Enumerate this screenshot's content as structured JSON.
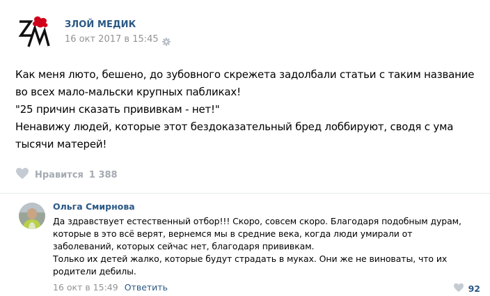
{
  "post": {
    "author": "ЗЛОЙ МЕДИК",
    "date": "16 окт 2017 в 15:45",
    "lines": [
      "Как меня люто, бешено, до зубовного скрежета задолбали статьи с таким название",
      "во всех мало-мальски крупных пабликах!",
      "\"25 причин сказать прививкам - нет!\"",
      "Ненавижу людей, которые этот бездоказательный бред лоббируют, сводя с ума",
      "тысячи матерей!"
    ],
    "like_label": "Нравится",
    "like_count": "1 388"
  },
  "comment": {
    "author": "Ольга Смирнова",
    "lines": [
      "Да здравствует естественный отбор!!! Скоро, совсем скоро. Благодаря подобным дурам,",
      "которые в это всё верят, вернемся мы в средние века, когда люди умирали от",
      "заболеваний, которых сейчас нет, благодаря прививкам.",
      "Только их детей жалко, которые будут страдать в муках. Они же не виноваты, что их",
      "родители дебилы."
    ],
    "date": "16 окт в 15:49",
    "reply_label": "Ответить",
    "like_count": "92"
  },
  "icons": {
    "logo": "zm-logo",
    "settings": "gear-icon",
    "like": "heart-icon"
  },
  "colors": {
    "link": "#2a5885",
    "meta": "#939393",
    "like_inactive": "#a4aab2",
    "logo_accent": "#d0021b"
  }
}
